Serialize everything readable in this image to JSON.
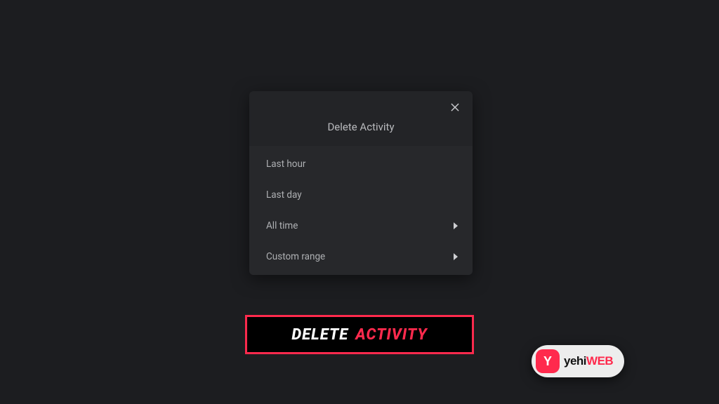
{
  "dialog": {
    "title": "Delete Activity",
    "options": [
      {
        "label": "Last hour",
        "has_arrow": false
      },
      {
        "label": "Last day",
        "has_arrow": false
      },
      {
        "label": "All time",
        "has_arrow": true
      },
      {
        "label": "Custom range",
        "has_arrow": true
      }
    ]
  },
  "caption": {
    "word1": "DELETE",
    "word2": "ACTIVITY"
  },
  "watermark": {
    "badge_letter": "Y",
    "text_part1": "yehi",
    "text_part2": "WEB"
  },
  "colors": {
    "accent": "#ff2a4d",
    "bg": "#1c1d20"
  }
}
